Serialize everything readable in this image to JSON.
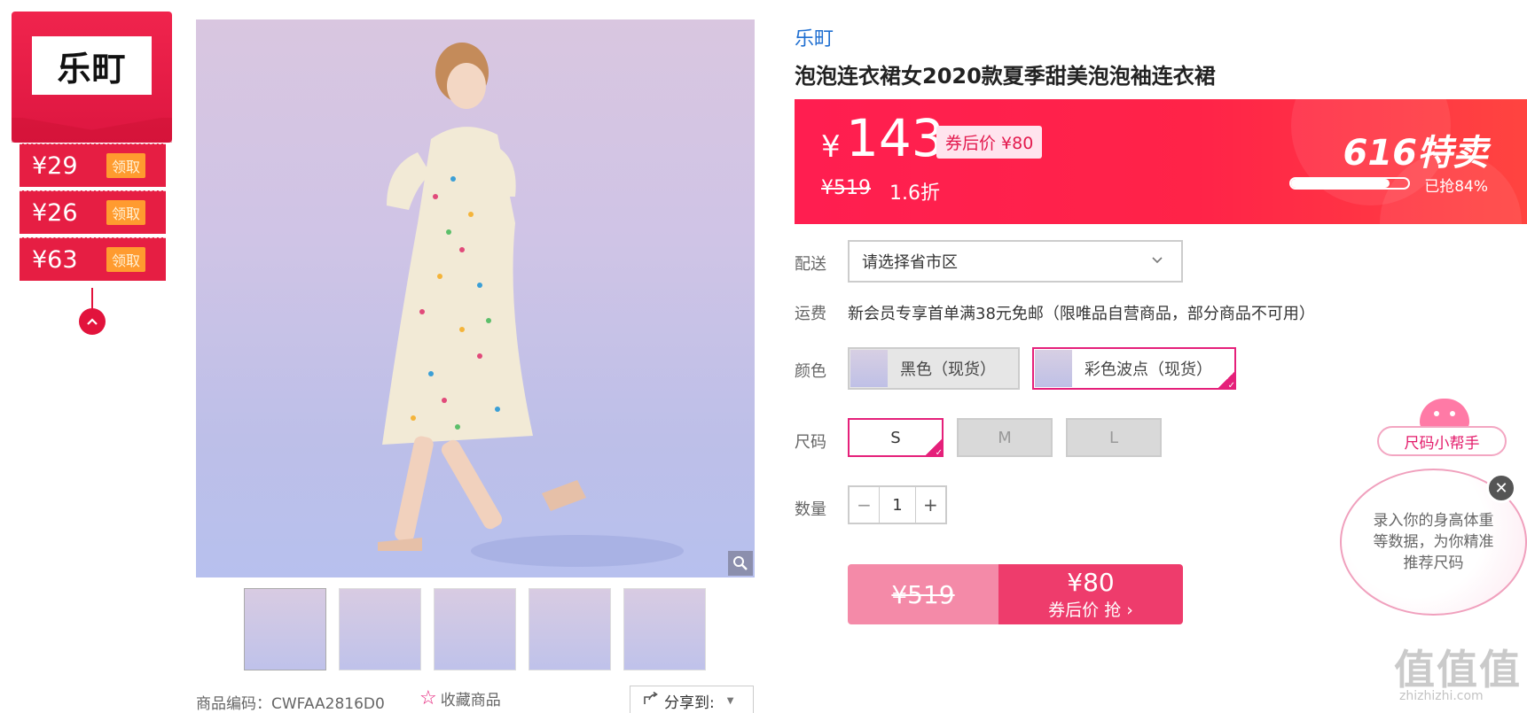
{
  "brand": {
    "logo_text": "乐町",
    "link": "乐町"
  },
  "coupons": [
    {
      "price": "¥29",
      "action": "领取"
    },
    {
      "price": "¥26",
      "action": "领取"
    },
    {
      "price": "¥63",
      "action": "领取"
    }
  ],
  "product": {
    "title": "泡泡连衣裙女2020款夏季甜美泡泡袖连衣裙",
    "code_label": "商品编码：CWFAA2816D0",
    "favorite_label": "收藏商品",
    "share_label": "分享到:"
  },
  "price": {
    "currency": "¥",
    "current": "143",
    "coupon_tag": "券后价 ¥80",
    "original": "¥519",
    "discount": "1.6折",
    "event": "616特卖",
    "sold_text": "已抢84%",
    "sold_fraction": 0.84
  },
  "delivery": {
    "label": "配送",
    "placeholder": "请选择省市区"
  },
  "shipping": {
    "label": "运费",
    "text": "新会员专享首单满38元免邮（限唯品自营商品，部分商品不可用）"
  },
  "color": {
    "label": "颜色",
    "options": [
      {
        "name": "黑色（现货）",
        "selected": false
      },
      {
        "name": "彩色波点（现货）",
        "selected": true
      }
    ]
  },
  "size": {
    "label": "尺码",
    "options": [
      {
        "name": "S",
        "selected": true
      },
      {
        "name": "M",
        "selected": false
      },
      {
        "name": "L",
        "selected": false
      }
    ]
  },
  "quantity": {
    "label": "数量",
    "minus": "−",
    "value": "1",
    "plus": "+"
  },
  "buy": {
    "original": "¥519",
    "coupon_price": "¥80",
    "cta": "券后价 抢 ›"
  },
  "size_helper": {
    "title": "尺码小帮手",
    "body": "录入你的身高体重等数据，为你精准推荐尺码",
    "close": "✕"
  },
  "watermark": {
    "text": "值值值",
    "url": "zhizhizhi.com"
  },
  "colors": {
    "accent": "#ff1e50",
    "pink": "#e5207a",
    "coupon_red": "#e61e43",
    "link_blue": "#1f6fd1"
  }
}
